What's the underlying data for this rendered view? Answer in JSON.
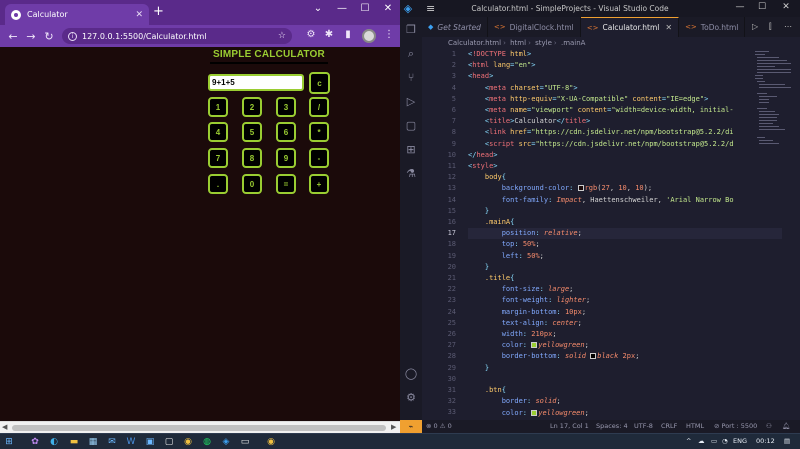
{
  "chrome": {
    "tab_title": "Calculator",
    "tab_close": "✕",
    "new_tab": "+",
    "window_buttons": [
      "⌄",
      "—",
      "☐",
      "✕"
    ],
    "nav": {
      "back": "←",
      "forward": "→",
      "reload": "↻"
    },
    "address": "127.0.0.1:5500/Calculator.html",
    "address_info_icon": "i",
    "star_icon": "☆",
    "toolbar_icons": [
      "⚙",
      "✱",
      "▮",
      "⋮"
    ]
  },
  "calculator": {
    "title": "SIMPLE CALCULATOR",
    "display_value": "9+1+5",
    "clear_label": "c",
    "keys": [
      [
        "1",
        "2",
        "3",
        "/"
      ],
      [
        "4",
        "5",
        "6",
        "*"
      ],
      [
        "7",
        "8",
        "9",
        "-"
      ],
      [
        ".",
        "0",
        "=",
        "+"
      ]
    ],
    "colors": {
      "accent": "#9acd32",
      "background": "#1b0a0a"
    }
  },
  "vscode": {
    "caption": "Calculator.html - SimpleProjects - Visual Studio Code",
    "window_buttons": [
      "—",
      "☐",
      "✕"
    ],
    "tabs": [
      {
        "label": "Get Started",
        "icon": "◆",
        "italic": true,
        "active": false
      },
      {
        "label": "DigitalClock.html",
        "icon": "<>",
        "italic": false,
        "active": false
      },
      {
        "label": "Calculator.html",
        "icon": "<>",
        "italic": false,
        "active": true
      },
      {
        "label": "ToDo.html",
        "icon": "<>",
        "italic": false,
        "active": false
      }
    ],
    "tab_actions": [
      "▷",
      "⫿",
      "⋯"
    ],
    "breadcrumb": [
      "Calculator.html",
      "html",
      "style",
      ".mainA"
    ],
    "line_numbers": [
      "1",
      "2",
      "3",
      "4",
      "5",
      "6",
      "7",
      "8",
      "9",
      "10",
      "11",
      "12",
      "13",
      "14",
      "15",
      "16",
      "17",
      "18",
      "19",
      "20",
      "21",
      "22",
      "23",
      "24",
      "25",
      "26",
      "27",
      "28",
      "29",
      "30",
      "31",
      "32",
      "33"
    ],
    "status": {
      "errors": "⊗ 0 ⚠ 0",
      "position": "Ln 17, Col 1",
      "spaces": "Spaces: 4",
      "encoding": "UTF-8",
      "eol": "CRLF",
      "language": "HTML",
      "port": "⊘ Port : 5500"
    }
  },
  "taskbar": {
    "language": "ENG",
    "time": "00:12",
    "tray_icons": [
      "^",
      "☁",
      "▭",
      "◔"
    ]
  }
}
